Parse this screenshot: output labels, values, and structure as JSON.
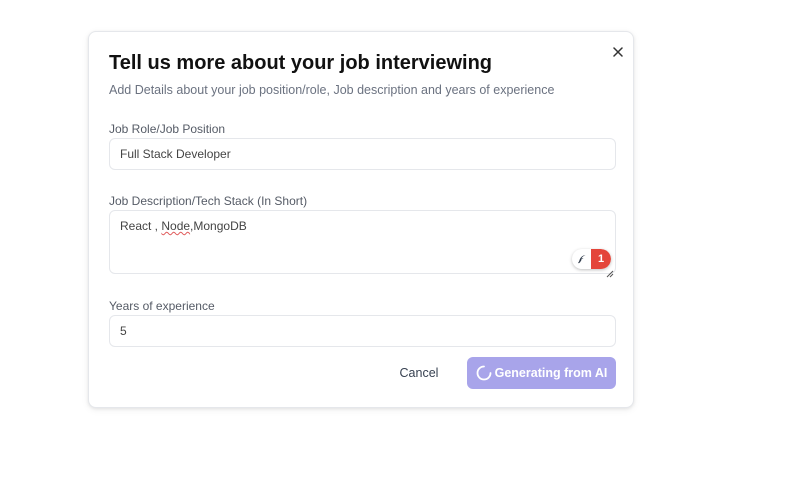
{
  "dialog": {
    "title": "Tell us more about your job interviewing",
    "subtitle": "Add Details about your job position/role, Job description and years of experience"
  },
  "form": {
    "job_role": {
      "label": "Job Role/Job Position",
      "value": "Full Stack Developer"
    },
    "job_description": {
      "label": "Job Description/Tech Stack (In Short)",
      "value_parts": [
        "React , ",
        "Node",
        ",MongoDB"
      ]
    },
    "experience": {
      "label": "Years of experience",
      "value": "5"
    }
  },
  "extension_badge": {
    "count": "1",
    "icon": "feather-icon",
    "color": "#e4453a"
  },
  "actions": {
    "cancel_label": "Cancel",
    "generate_label": "Generating from AI",
    "generate_color": "#a8a4ea"
  },
  "icons": {
    "close": "close-icon",
    "spinner": "loader-icon"
  }
}
